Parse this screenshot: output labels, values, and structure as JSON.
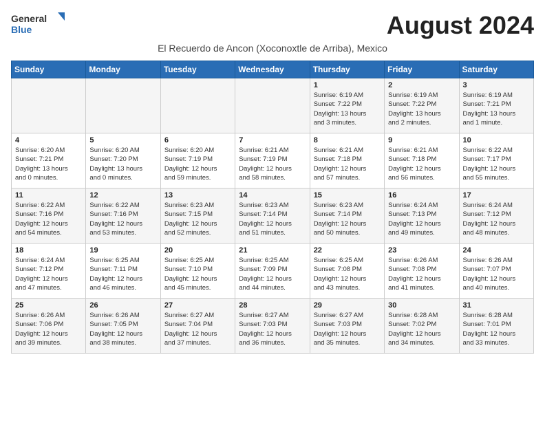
{
  "logo": {
    "general": "General",
    "blue": "Blue"
  },
  "month_title": "August 2024",
  "location": "El Recuerdo de Ancon (Xoconoxtle de Arriba), Mexico",
  "days_of_week": [
    "Sunday",
    "Monday",
    "Tuesday",
    "Wednesday",
    "Thursday",
    "Friday",
    "Saturday"
  ],
  "weeks": [
    [
      {
        "day": "",
        "info": ""
      },
      {
        "day": "",
        "info": ""
      },
      {
        "day": "",
        "info": ""
      },
      {
        "day": "",
        "info": ""
      },
      {
        "day": "1",
        "info": "Sunrise: 6:19 AM\nSunset: 7:22 PM\nDaylight: 13 hours\nand 3 minutes."
      },
      {
        "day": "2",
        "info": "Sunrise: 6:19 AM\nSunset: 7:22 PM\nDaylight: 13 hours\nand 2 minutes."
      },
      {
        "day": "3",
        "info": "Sunrise: 6:19 AM\nSunset: 7:21 PM\nDaylight: 13 hours\nand 1 minute."
      }
    ],
    [
      {
        "day": "4",
        "info": "Sunrise: 6:20 AM\nSunset: 7:21 PM\nDaylight: 13 hours\nand 0 minutes."
      },
      {
        "day": "5",
        "info": "Sunrise: 6:20 AM\nSunset: 7:20 PM\nDaylight: 13 hours\nand 0 minutes."
      },
      {
        "day": "6",
        "info": "Sunrise: 6:20 AM\nSunset: 7:19 PM\nDaylight: 12 hours\nand 59 minutes."
      },
      {
        "day": "7",
        "info": "Sunrise: 6:21 AM\nSunset: 7:19 PM\nDaylight: 12 hours\nand 58 minutes."
      },
      {
        "day": "8",
        "info": "Sunrise: 6:21 AM\nSunset: 7:18 PM\nDaylight: 12 hours\nand 57 minutes."
      },
      {
        "day": "9",
        "info": "Sunrise: 6:21 AM\nSunset: 7:18 PM\nDaylight: 12 hours\nand 56 minutes."
      },
      {
        "day": "10",
        "info": "Sunrise: 6:22 AM\nSunset: 7:17 PM\nDaylight: 12 hours\nand 55 minutes."
      }
    ],
    [
      {
        "day": "11",
        "info": "Sunrise: 6:22 AM\nSunset: 7:16 PM\nDaylight: 12 hours\nand 54 minutes."
      },
      {
        "day": "12",
        "info": "Sunrise: 6:22 AM\nSunset: 7:16 PM\nDaylight: 12 hours\nand 53 minutes."
      },
      {
        "day": "13",
        "info": "Sunrise: 6:23 AM\nSunset: 7:15 PM\nDaylight: 12 hours\nand 52 minutes."
      },
      {
        "day": "14",
        "info": "Sunrise: 6:23 AM\nSunset: 7:14 PM\nDaylight: 12 hours\nand 51 minutes."
      },
      {
        "day": "15",
        "info": "Sunrise: 6:23 AM\nSunset: 7:14 PM\nDaylight: 12 hours\nand 50 minutes."
      },
      {
        "day": "16",
        "info": "Sunrise: 6:24 AM\nSunset: 7:13 PM\nDaylight: 12 hours\nand 49 minutes."
      },
      {
        "day": "17",
        "info": "Sunrise: 6:24 AM\nSunset: 7:12 PM\nDaylight: 12 hours\nand 48 minutes."
      }
    ],
    [
      {
        "day": "18",
        "info": "Sunrise: 6:24 AM\nSunset: 7:12 PM\nDaylight: 12 hours\nand 47 minutes."
      },
      {
        "day": "19",
        "info": "Sunrise: 6:25 AM\nSunset: 7:11 PM\nDaylight: 12 hours\nand 46 minutes."
      },
      {
        "day": "20",
        "info": "Sunrise: 6:25 AM\nSunset: 7:10 PM\nDaylight: 12 hours\nand 45 minutes."
      },
      {
        "day": "21",
        "info": "Sunrise: 6:25 AM\nSunset: 7:09 PM\nDaylight: 12 hours\nand 44 minutes."
      },
      {
        "day": "22",
        "info": "Sunrise: 6:25 AM\nSunset: 7:08 PM\nDaylight: 12 hours\nand 43 minutes."
      },
      {
        "day": "23",
        "info": "Sunrise: 6:26 AM\nSunset: 7:08 PM\nDaylight: 12 hours\nand 41 minutes."
      },
      {
        "day": "24",
        "info": "Sunrise: 6:26 AM\nSunset: 7:07 PM\nDaylight: 12 hours\nand 40 minutes."
      }
    ],
    [
      {
        "day": "25",
        "info": "Sunrise: 6:26 AM\nSunset: 7:06 PM\nDaylight: 12 hours\nand 39 minutes."
      },
      {
        "day": "26",
        "info": "Sunrise: 6:26 AM\nSunset: 7:05 PM\nDaylight: 12 hours\nand 38 minutes."
      },
      {
        "day": "27",
        "info": "Sunrise: 6:27 AM\nSunset: 7:04 PM\nDaylight: 12 hours\nand 37 minutes."
      },
      {
        "day": "28",
        "info": "Sunrise: 6:27 AM\nSunset: 7:03 PM\nDaylight: 12 hours\nand 36 minutes."
      },
      {
        "day": "29",
        "info": "Sunrise: 6:27 AM\nSunset: 7:03 PM\nDaylight: 12 hours\nand 35 minutes."
      },
      {
        "day": "30",
        "info": "Sunrise: 6:28 AM\nSunset: 7:02 PM\nDaylight: 12 hours\nand 34 minutes."
      },
      {
        "day": "31",
        "info": "Sunrise: 6:28 AM\nSunset: 7:01 PM\nDaylight: 12 hours\nand 33 minutes."
      }
    ]
  ]
}
